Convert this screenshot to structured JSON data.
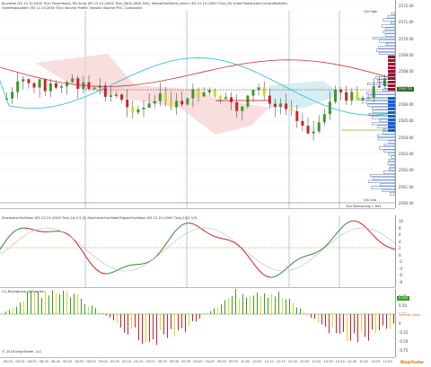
{
  "price_pane": {
    "header_1": "Kurzarbe (ES 12-10,2000 Tick) Prozentsatz, RR-Schw (ES 12-10 (2000 Tick),1800,1800,300), MorepFlowTrend_simmr (ES 12-10 (2000 Tick),20) OrderFlowAuctionCurrentBarData",
    "header_2": "OrderflowLadder (ES 12-10,2000 Tick) Volume Profile, Session Volume POC, Composite",
    "label_top": "Ctx High",
    "label_bottom": "Ctx Low",
    "label_status": "Tick Remaining = 643",
    "y_ticks": [
      "2572.00",
      "2571.00",
      "2570.00",
      "2569.00",
      "2568.00",
      "2567.00",
      "2566.00",
      "2565.00",
      "2564.00",
      "2563.00",
      "2562.00",
      "2561.00",
      "2560.00"
    ],
    "current_price": "2567.50"
  },
  "oscillator_pane": {
    "header": "StochasticOscillator (ES 12-10 (2000 Tick),14,3,3,3), StochasticOscillatorTriggerOscillator (ES 12-10 (2000 Tick),14,3,3,3)",
    "y_ticks": [
      "10",
      "8",
      "6",
      "4",
      "2",
      "0",
      "-2",
      "-4",
      "-6",
      "-8"
    ]
  },
  "histogram_pane": {
    "header": "CS_Divergence_Histogram",
    "y_ticks": [
      "0.75",
      "0.50",
      "0.25",
      "0",
      "-0.25",
      "-0.50",
      "-0.75"
    ],
    "tag_value": "0.342",
    "tag_status": "Neutral Level",
    "copyright": "© 2018 NinjaTrader, LLC"
  },
  "x_axis": {
    "labels": [
      "08:20",
      "08:25",
      "08:30",
      "08:35",
      "08:40",
      "08:45",
      "08:50",
      "08:55",
      "09:00",
      "09:05",
      "09:10",
      "09:15",
      "09:20",
      "09:25",
      "09:30",
      "09:35",
      "09:40",
      "09:45",
      "09:50",
      "09:55",
      "10:00",
      "10:05",
      "10:10",
      "10:15",
      "10:20",
      "10:25",
      "10:30",
      "10:35",
      "10:40",
      "10:45",
      "10:50",
      "10:55",
      "11:00"
    ]
  },
  "logo": "NinjaTrader",
  "colors": {
    "up": "#3a9a2a",
    "down": "#d0202a",
    "neutral": "#d8d820",
    "ema_red": "#cc3333",
    "ema_cyan": "#22bbcc",
    "profile": "#2255aa"
  }
}
